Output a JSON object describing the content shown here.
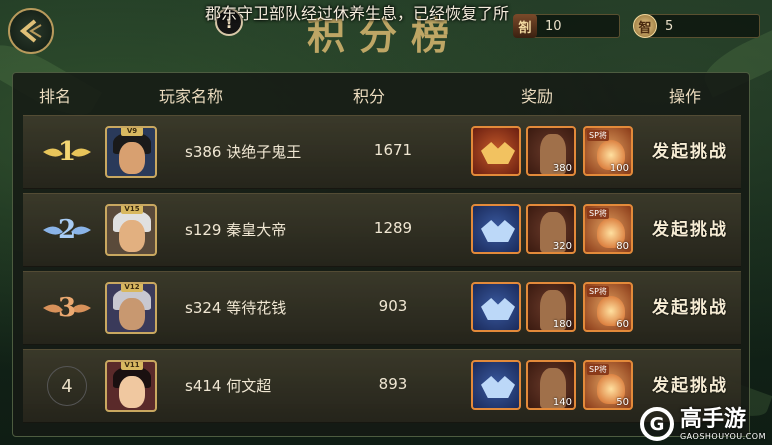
{
  "top": {
    "notice": "郡东守卫部队经过休养生息，已经恢复了所",
    "title": "积分榜",
    "alert_glyph": "!",
    "resources": [
      {
        "icon": "token-icon",
        "glyph": "劄",
        "value": "10"
      },
      {
        "icon": "wisdom-icon",
        "glyph": "智",
        "value": "5"
      }
    ]
  },
  "table": {
    "headers": [
      "排名",
      "玩家名称",
      "积分",
      "奖励",
      "操作"
    ],
    "rows": [
      {
        "rank": "1",
        "badge": "gold",
        "vip": "V9",
        "name": "s386 诀绝子鬼王",
        "score": "1671",
        "rewards": [
          {
            "type": "badge",
            "count": ""
          },
          {
            "type": "hero",
            "count": "380"
          },
          {
            "type": "sp",
            "label": "SP将",
            "count": "100"
          }
        ],
        "action": "发起挑战"
      },
      {
        "rank": "2",
        "badge": "silver",
        "vip": "V15",
        "name": "s129 秦皇大帝",
        "score": "1289",
        "rewards": [
          {
            "type": "badge",
            "count": ""
          },
          {
            "type": "hero",
            "count": "320"
          },
          {
            "type": "sp",
            "label": "SP将",
            "count": "80"
          }
        ],
        "action": "发起挑战"
      },
      {
        "rank": "3",
        "badge": "bronze",
        "vip": "V12",
        "name": "s324 等待花钱",
        "score": "903",
        "rewards": [
          {
            "type": "badge",
            "count": ""
          },
          {
            "type": "hero",
            "count": "180"
          },
          {
            "type": "sp",
            "label": "SP将",
            "count": "60"
          }
        ],
        "action": "发起挑战"
      },
      {
        "rank": "4",
        "badge": "none",
        "vip": "V11",
        "name": "s414 何文超",
        "score": "893",
        "rewards": [
          {
            "type": "badge",
            "count": ""
          },
          {
            "type": "hero",
            "count": "140"
          },
          {
            "type": "sp",
            "label": "SP将",
            "count": "50"
          }
        ],
        "action": "发起挑战"
      }
    ]
  },
  "watermark": {
    "glyph": "G",
    "brand": "高手游",
    "url": "GAOSHOUYOU.COM"
  },
  "colors": {
    "gold": "#e8c55a",
    "silver": "#8ab4e8",
    "bronze": "#d8915a",
    "accent": "#e38a3a"
  }
}
